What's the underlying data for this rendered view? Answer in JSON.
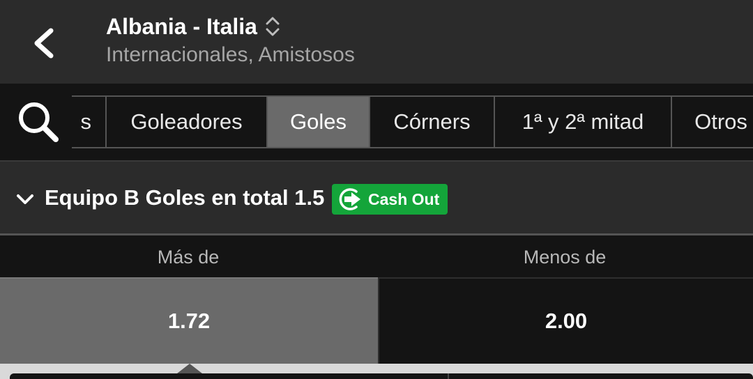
{
  "header": {
    "title": "Albania - Italia",
    "subtitle": "Internacionales, Amistosos",
    "icons": [
      "back-arrow-icon",
      "sort-chevrons-icon"
    ]
  },
  "tabs": [
    {
      "label": "s",
      "active": false
    },
    {
      "label": "Goleadores",
      "active": false
    },
    {
      "label": "Goles",
      "active": true
    },
    {
      "label": "Córners",
      "active": false
    },
    {
      "label": "1ª y 2ª mitad",
      "active": false
    },
    {
      "label": "Otros",
      "active": false
    }
  ],
  "market": {
    "title": "Equipo B Goles en total 1.5",
    "cashout_label": "Cash Out",
    "cashout_color": "#14a53a"
  },
  "columns": {
    "over_label": "Más de",
    "under_label": "Menos de"
  },
  "odds": {
    "over": "1.72",
    "under": "2.00",
    "selected": "over"
  },
  "colors": {
    "header_bg": "#2b2b2b",
    "page_bg": "#141414",
    "active_tab_bg": "#6a6a6a",
    "selected_odd_bg": "#6a6a6a"
  }
}
